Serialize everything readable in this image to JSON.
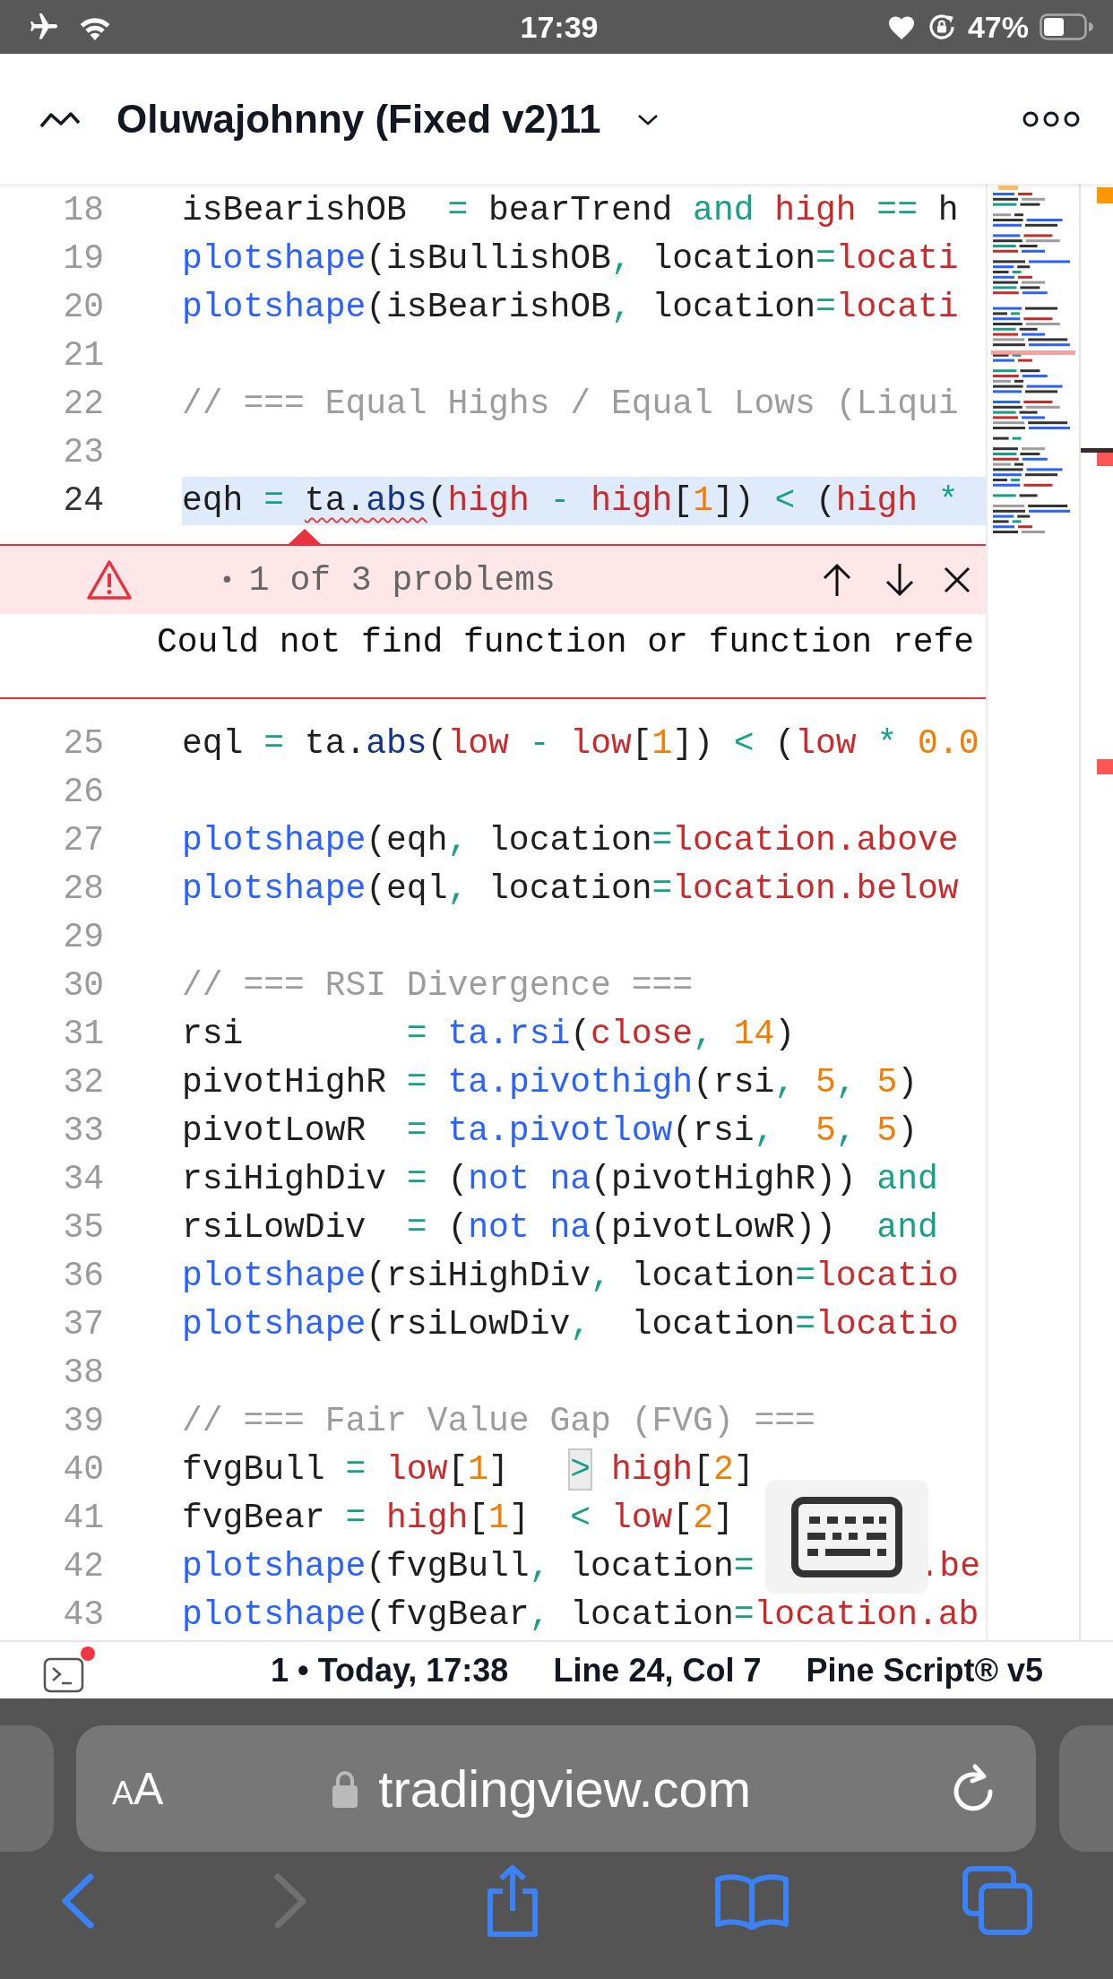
{
  "status_bar": {
    "time": "17:39",
    "battery": "47%"
  },
  "header": {
    "title": "Oluwajohnny (Fixed v2)11"
  },
  "editor": {
    "lines_before_problem": [
      {
        "number": "18",
        "active": false,
        "tokens": [
          {
            "kind": "plain",
            "text": "isBearishOB"
          },
          {
            "kind": "op",
            "text": "  = "
          },
          {
            "kind": "plain",
            "text": "bearTrend"
          },
          {
            "kind": "op",
            "text": " and "
          },
          {
            "kind": "var",
            "text": "high"
          },
          {
            "kind": "op",
            "text": " == "
          },
          {
            "kind": "plain",
            "text": "h"
          }
        ]
      },
      {
        "number": "19",
        "active": false,
        "tokens": [
          {
            "kind": "fn",
            "text": "plotshape"
          },
          {
            "kind": "plain",
            "text": "(isBullishOB"
          },
          {
            "kind": "op",
            "text": ", "
          },
          {
            "kind": "plain",
            "text": "location"
          },
          {
            "kind": "op",
            "text": "="
          },
          {
            "kind": "var",
            "text": "locati"
          }
        ]
      },
      {
        "number": "20",
        "active": false,
        "tokens": [
          {
            "kind": "fn",
            "text": "plotshape"
          },
          {
            "kind": "plain",
            "text": "(isBearishOB"
          },
          {
            "kind": "op",
            "text": ", "
          },
          {
            "kind": "plain",
            "text": "location"
          },
          {
            "kind": "op",
            "text": "="
          },
          {
            "kind": "var",
            "text": "locati"
          }
        ]
      },
      {
        "number": "21",
        "active": false
      },
      {
        "number": "22",
        "active": false,
        "tokens": [
          {
            "kind": "comment",
            "text": "// === Equal Highs / Equal Lows (Liqui"
          }
        ]
      },
      {
        "number": "23",
        "active": false
      },
      {
        "number": "24",
        "active": true,
        "tokens": [
          {
            "kind": "plain",
            "text": "eqh"
          },
          {
            "kind": "op",
            "text": " = "
          },
          {
            "kind": "plain",
            "text": "ta.",
            "error": true
          },
          {
            "kind": "method",
            "text": "abs",
            "error": true
          },
          {
            "kind": "plain",
            "text": "("
          },
          {
            "kind": "var",
            "text": "high"
          },
          {
            "kind": "op",
            "text": " - "
          },
          {
            "kind": "var",
            "text": "high"
          },
          {
            "kind": "plain",
            "text": "["
          },
          {
            "kind": "num",
            "text": "1"
          },
          {
            "kind": "plain",
            "text": "])"
          },
          {
            "kind": "op",
            "text": " < "
          },
          {
            "kind": "plain",
            "text": "("
          },
          {
            "kind": "var",
            "text": "high"
          },
          {
            "kind": "op",
            "text": " *"
          }
        ]
      }
    ],
    "problem": {
      "bullet": "•",
      "counter": "1 of 3 problems",
      "message": "Could not find function or function refe"
    },
    "lines_after_problem": [
      {
        "number": "25",
        "active": false,
        "tokens": [
          {
            "kind": "plain",
            "text": "eql"
          },
          {
            "kind": "op",
            "text": " = "
          },
          {
            "kind": "plain",
            "text": "ta."
          },
          {
            "kind": "method",
            "text": "abs"
          },
          {
            "kind": "plain",
            "text": "("
          },
          {
            "kind": "var",
            "text": "low"
          },
          {
            "kind": "op",
            "text": " - "
          },
          {
            "kind": "var",
            "text": "low"
          },
          {
            "kind": "plain",
            "text": "["
          },
          {
            "kind": "num",
            "text": "1"
          },
          {
            "kind": "plain",
            "text": "])"
          },
          {
            "kind": "op",
            "text": " < "
          },
          {
            "kind": "plain",
            "text": "("
          },
          {
            "kind": "var",
            "text": "low"
          },
          {
            "kind": "op",
            "text": " * "
          },
          {
            "kind": "num",
            "text": "0.0"
          }
        ]
      },
      {
        "number": "26",
        "active": false
      },
      {
        "number": "27",
        "active": false,
        "tokens": [
          {
            "kind": "fn",
            "text": "plotshape"
          },
          {
            "kind": "plain",
            "text": "(eqh"
          },
          {
            "kind": "op",
            "text": ", "
          },
          {
            "kind": "plain",
            "text": "location"
          },
          {
            "kind": "op",
            "text": "="
          },
          {
            "kind": "var",
            "text": "location.above"
          }
        ]
      },
      {
        "number": "28",
        "active": false,
        "tokens": [
          {
            "kind": "fn",
            "text": "plotshape"
          },
          {
            "kind": "plain",
            "text": "(eql"
          },
          {
            "kind": "op",
            "text": ", "
          },
          {
            "kind": "plain",
            "text": "location"
          },
          {
            "kind": "op",
            "text": "="
          },
          {
            "kind": "var",
            "text": "location.below"
          }
        ]
      },
      {
        "number": "29",
        "active": false
      },
      {
        "number": "30",
        "active": false,
        "tokens": [
          {
            "kind": "comment",
            "text": "// === RSI Divergence ==="
          }
        ]
      },
      {
        "number": "31",
        "active": false,
        "tokens": [
          {
            "kind": "plain",
            "text": "rsi"
          },
          {
            "kind": "op",
            "text": "        = "
          },
          {
            "kind": "fn",
            "text": "ta.rsi"
          },
          {
            "kind": "plain",
            "text": "("
          },
          {
            "kind": "var",
            "text": "close"
          },
          {
            "kind": "op",
            "text": ", "
          },
          {
            "kind": "num",
            "text": "14"
          },
          {
            "kind": "plain",
            "text": ")"
          }
        ]
      },
      {
        "number": "32",
        "active": false,
        "tokens": [
          {
            "kind": "plain",
            "text": "pivotHighR"
          },
          {
            "kind": "op",
            "text": " = "
          },
          {
            "kind": "fn",
            "text": "ta.pivothigh"
          },
          {
            "kind": "plain",
            "text": "(rsi"
          },
          {
            "kind": "op",
            "text": ", "
          },
          {
            "kind": "num",
            "text": "5"
          },
          {
            "kind": "op",
            "text": ", "
          },
          {
            "kind": "num",
            "text": "5"
          },
          {
            "kind": "plain",
            "text": ")"
          }
        ]
      },
      {
        "number": "33",
        "active": false,
        "tokens": [
          {
            "kind": "plain",
            "text": "pivotLowR"
          },
          {
            "kind": "op",
            "text": "  = "
          },
          {
            "kind": "fn",
            "text": "ta.pivotlow"
          },
          {
            "kind": "plain",
            "text": "(rsi"
          },
          {
            "kind": "op",
            "text": ",  "
          },
          {
            "kind": "num",
            "text": "5"
          },
          {
            "kind": "op",
            "text": ", "
          },
          {
            "kind": "num",
            "text": "5"
          },
          {
            "kind": "plain",
            "text": ")"
          }
        ]
      },
      {
        "number": "34",
        "active": false,
        "tokens": [
          {
            "kind": "plain",
            "text": "rsiHighDiv"
          },
          {
            "kind": "op",
            "text": " = "
          },
          {
            "kind": "plain",
            "text": "("
          },
          {
            "kind": "fn",
            "text": "not na"
          },
          {
            "kind": "plain",
            "text": "(pivotHighR))"
          },
          {
            "kind": "op",
            "text": " and"
          }
        ]
      },
      {
        "number": "35",
        "active": false,
        "tokens": [
          {
            "kind": "plain",
            "text": "rsiLowDiv"
          },
          {
            "kind": "op",
            "text": "  = "
          },
          {
            "kind": "plain",
            "text": "("
          },
          {
            "kind": "fn",
            "text": "not na"
          },
          {
            "kind": "plain",
            "text": "(pivotLowR))"
          },
          {
            "kind": "op",
            "text": "  and"
          }
        ]
      },
      {
        "number": "36",
        "active": false,
        "tokens": [
          {
            "kind": "fn",
            "text": "plotshape"
          },
          {
            "kind": "plain",
            "text": "(rsiHighDiv"
          },
          {
            "kind": "op",
            "text": ", "
          },
          {
            "kind": "plain",
            "text": "location"
          },
          {
            "kind": "op",
            "text": "="
          },
          {
            "kind": "var",
            "text": "locatio"
          }
        ]
      },
      {
        "number": "37",
        "active": false,
        "tokens": [
          {
            "kind": "fn",
            "text": "plotshape"
          },
          {
            "kind": "plain",
            "text": "(rsiLowDiv"
          },
          {
            "kind": "op",
            "text": ",  "
          },
          {
            "kind": "plain",
            "text": "location"
          },
          {
            "kind": "op",
            "text": "="
          },
          {
            "kind": "var",
            "text": "locatio"
          }
        ]
      },
      {
        "number": "38",
        "active": false
      },
      {
        "number": "39",
        "active": false,
        "tokens": [
          {
            "kind": "comment",
            "text": "// === Fair Value Gap (FVG) ==="
          }
        ]
      },
      {
        "number": "40",
        "active": false,
        "tokens": [
          {
            "kind": "plain",
            "text": "fvgBull"
          },
          {
            "kind": "op",
            "text": " = "
          },
          {
            "kind": "var",
            "text": "low"
          },
          {
            "kind": "plain",
            "text": "["
          },
          {
            "kind": "num",
            "text": "1"
          },
          {
            "kind": "plain",
            "text": "]   "
          },
          {
            "kind": "op",
            "text": ">",
            "boxed": true
          },
          {
            "kind": "var",
            "text": " high"
          },
          {
            "kind": "plain",
            "text": "["
          },
          {
            "kind": "num",
            "text": "2"
          },
          {
            "kind": "plain",
            "text": "]"
          }
        ]
      },
      {
        "number": "41",
        "active": false,
        "tokens": [
          {
            "kind": "plain",
            "text": "fvgBear"
          },
          {
            "kind": "op",
            "text": " = "
          },
          {
            "kind": "var",
            "text": "high"
          },
          {
            "kind": "plain",
            "text": "["
          },
          {
            "kind": "num",
            "text": "1"
          },
          {
            "kind": "plain",
            "text": "]  "
          },
          {
            "kind": "op",
            "text": "<"
          },
          {
            "kind": "var",
            "text": " low"
          },
          {
            "kind": "plain",
            "text": "["
          },
          {
            "kind": "num",
            "text": "2"
          },
          {
            "kind": "plain",
            "text": "]"
          }
        ]
      },
      {
        "number": "42",
        "active": false,
        "tokens": [
          {
            "kind": "fn",
            "text": "plotshape"
          },
          {
            "kind": "plain",
            "text": "(fvgBull"
          },
          {
            "kind": "op",
            "text": ", "
          },
          {
            "kind": "plain",
            "text": "location"
          },
          {
            "kind": "op",
            "text": "="
          }
        ],
        "tokens_after_keyboard": [
          {
            "kind": "var",
            "text": ".be"
          }
        ]
      },
      {
        "number": "43",
        "active": false,
        "tokens": [
          {
            "kind": "fn",
            "text": "plotshape"
          },
          {
            "kind": "plain",
            "text": "(fvgBear"
          },
          {
            "kind": "op",
            "text": ", "
          },
          {
            "kind": "plain",
            "text": "location"
          },
          {
            "kind": "op",
            "text": "="
          },
          {
            "kind": "var",
            "text": "location.ab"
          }
        ]
      }
    ]
  },
  "footer": {
    "version": "1 • Today, 17:38",
    "cursor": "Line 24, Col 7",
    "language": "Pine Script® v5"
  },
  "browser": {
    "text_size": "AA",
    "url": "tradingview.com",
    "back": {
      "disabled": false
    },
    "forward": {
      "disabled": true
    }
  }
}
